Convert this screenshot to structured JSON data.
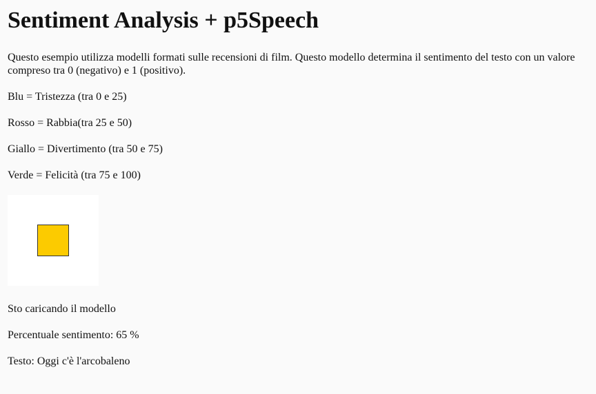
{
  "page": {
    "title": "Sentiment Analysis + p5Speech",
    "intro": "Questo esempio utilizza modelli formati sulle recensioni di film. Questo modello determina il sentimento del testo con un valore compreso tra 0 (negativo) e 1 (positivo).",
    "legend": [
      "Blu = Tristezza (tra 0 e 25)",
      "Rosso = Rabbia(tra 25 e 50)",
      "Giallo = Divertimento (tra 50 e 75)",
      "Verde = Felicità (tra 75 e 100)"
    ]
  },
  "sketch": {
    "square_color": "#fccb00",
    "background_color": "#ffffff"
  },
  "status": {
    "model": "Sto caricando il modello",
    "sentiment": "Percentuale sentimento: 65 %",
    "text": "Testo: Oggi c'è l'arcobaleno"
  }
}
